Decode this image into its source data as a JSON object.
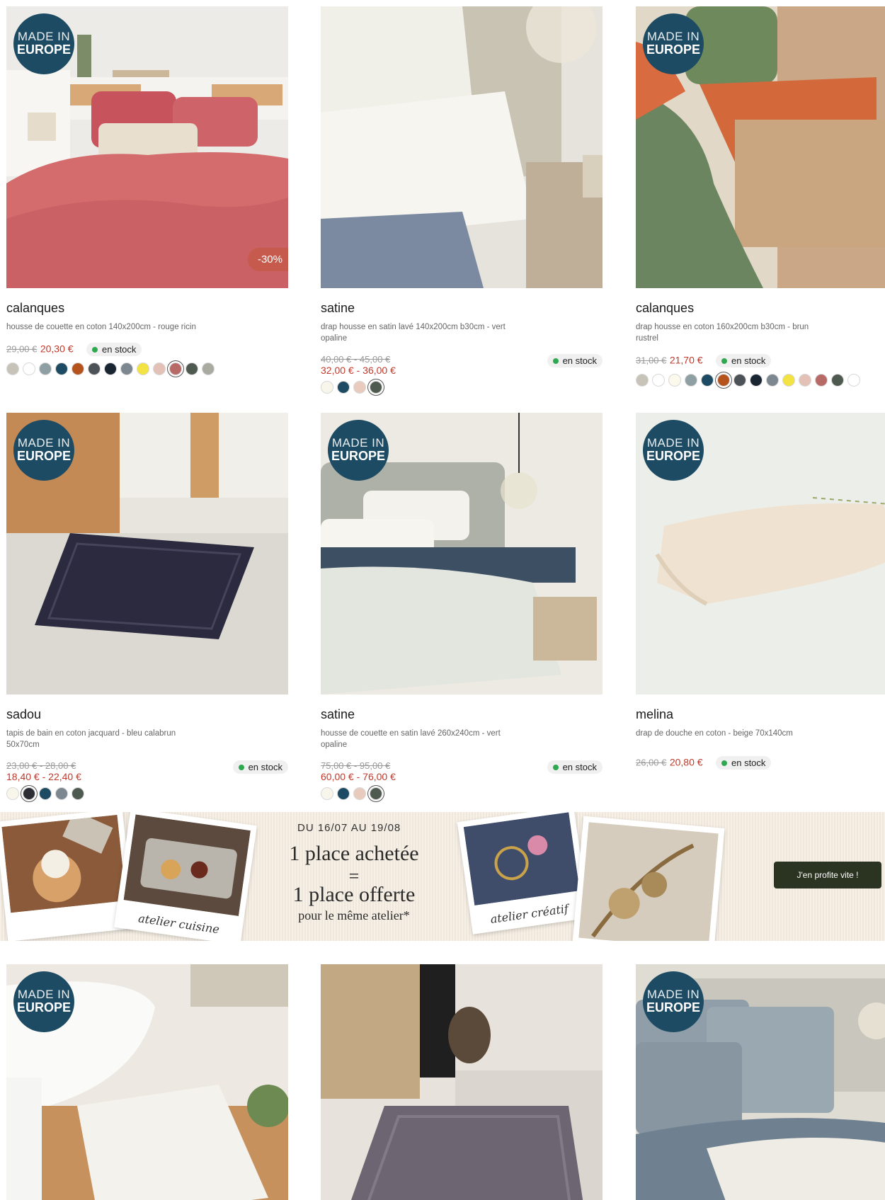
{
  "badge": {
    "line1": "MADE IN",
    "line2": "EUROPE"
  },
  "stock_label": "en stock",
  "products": [
    {
      "name": "calanques",
      "desc": "housse de couette en coton 140x200cm - rouge ricin",
      "old": "29,00 €",
      "new": "20,30 €",
      "discount": "-30%",
      "swatches": [
        "#c8c3b8",
        "#ffffff",
        "#8fa0a4",
        "#1d4b63",
        "#b5531c",
        "#4c5257",
        "#1a2532",
        "#7c8790",
        "#f2e342",
        "#e3c1b7",
        "#b76a66",
        "#4e5a4f",
        "#a9aaa0"
      ],
      "selected": 10
    },
    {
      "name": "satine",
      "desc": "drap housse en satin lavé 140x200cm b30cm - vert opaline",
      "old": "40,00 € - 45,00 €",
      "new": "32,00 € - 36,00 €",
      "swatches": [
        "#f8f6ea",
        "#1d4b63",
        "#e9cbbd",
        "#4e5a4f"
      ],
      "selected": 3
    },
    {
      "name": "calanques",
      "desc": "drap housse en coton 160x200cm b30cm - brun rustrel",
      "old": "31,00 €",
      "new": "21,70 €",
      "swatches": [
        "#c8c3b8",
        "#ffffff",
        "#fbf8ec",
        "#8fa0a4",
        "#1d4b63",
        "#b5531c",
        "#4c5257",
        "#1a2532",
        "#7c8790",
        "#f2e342",
        "#e3c1b7",
        "#b76a66",
        "#4e5a4f",
        "#ffffff"
      ],
      "selected": 5
    },
    {
      "name": "sadou",
      "desc": "tapis de bain en coton jacquard - bleu calabrun 50x70cm",
      "old": "23,00 € - 28,00 €",
      "new": "18,40 € - 22,40 €",
      "swatches": [
        "#f8f6ea",
        "#2c2d35",
        "#1d4b63",
        "#7c8790",
        "#4e5a4f"
      ],
      "selected": 1
    },
    {
      "name": "satine",
      "desc": "housse de couette en satin lavé 260x240cm - vert opaline",
      "old": "75,00 € - 95,00 €",
      "new": "60,00 € - 76,00 €",
      "swatches": [
        "#f8f6ea",
        "#1d4b63",
        "#e9cbbd",
        "#4e5a4f"
      ],
      "selected": 3
    },
    {
      "name": "melina",
      "desc": "drap de douche en coton - beige 70x140cm",
      "old": "26,00 €",
      "new": "20,80 €",
      "swatches": []
    }
  ],
  "banner": {
    "date": "DU 16/07 AU 19/08",
    "line1": "1 place achetée",
    "line2": "=",
    "line3": "1 place offerte",
    "line4": "pour le même atelier*",
    "caption_left": "atelier cuisine",
    "caption_right": "atelier créatif",
    "cta": "J'en profite vite !"
  }
}
